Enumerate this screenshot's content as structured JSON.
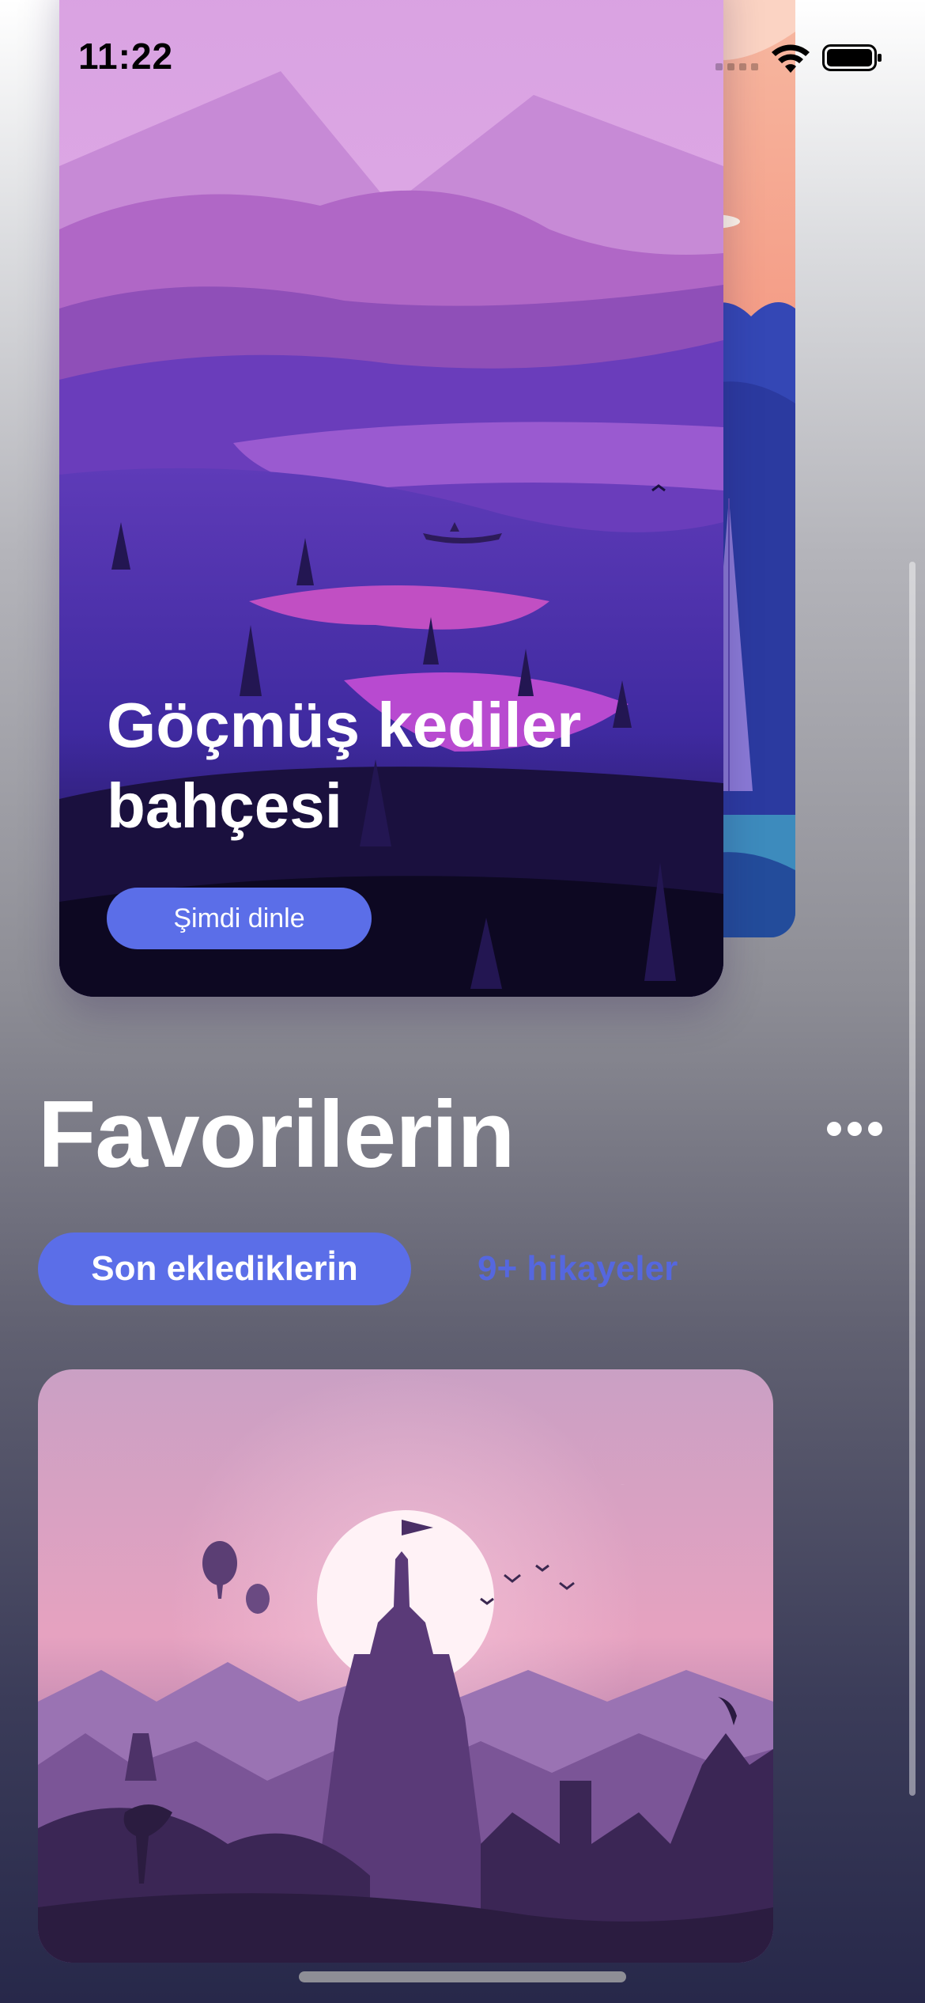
{
  "status_bar": {
    "time": "11:22",
    "icons": [
      "signal-icon",
      "wifi-icon",
      "battery-icon"
    ]
  },
  "featured_story": {
    "title": "Göçmüş kediler bahçesi",
    "button_label": "Şimdi dinle",
    "artwork": "purple-mountain-lake-illustration"
  },
  "next_story": {
    "artwork": "coral-blue-forest-illustration"
  },
  "favorites": {
    "title": "Favorilerin",
    "more_icon": "more-dots-icon",
    "tabs": [
      {
        "label": "Son ekledikleri̇n",
        "active": true
      },
      {
        "label": "9+ hikayeler",
        "active": false
      }
    ],
    "card_artwork": "pink-sunset-castle-illustration"
  },
  "colors": {
    "accent": "#5b6ee8",
    "inactive_tab": "#5567df"
  }
}
